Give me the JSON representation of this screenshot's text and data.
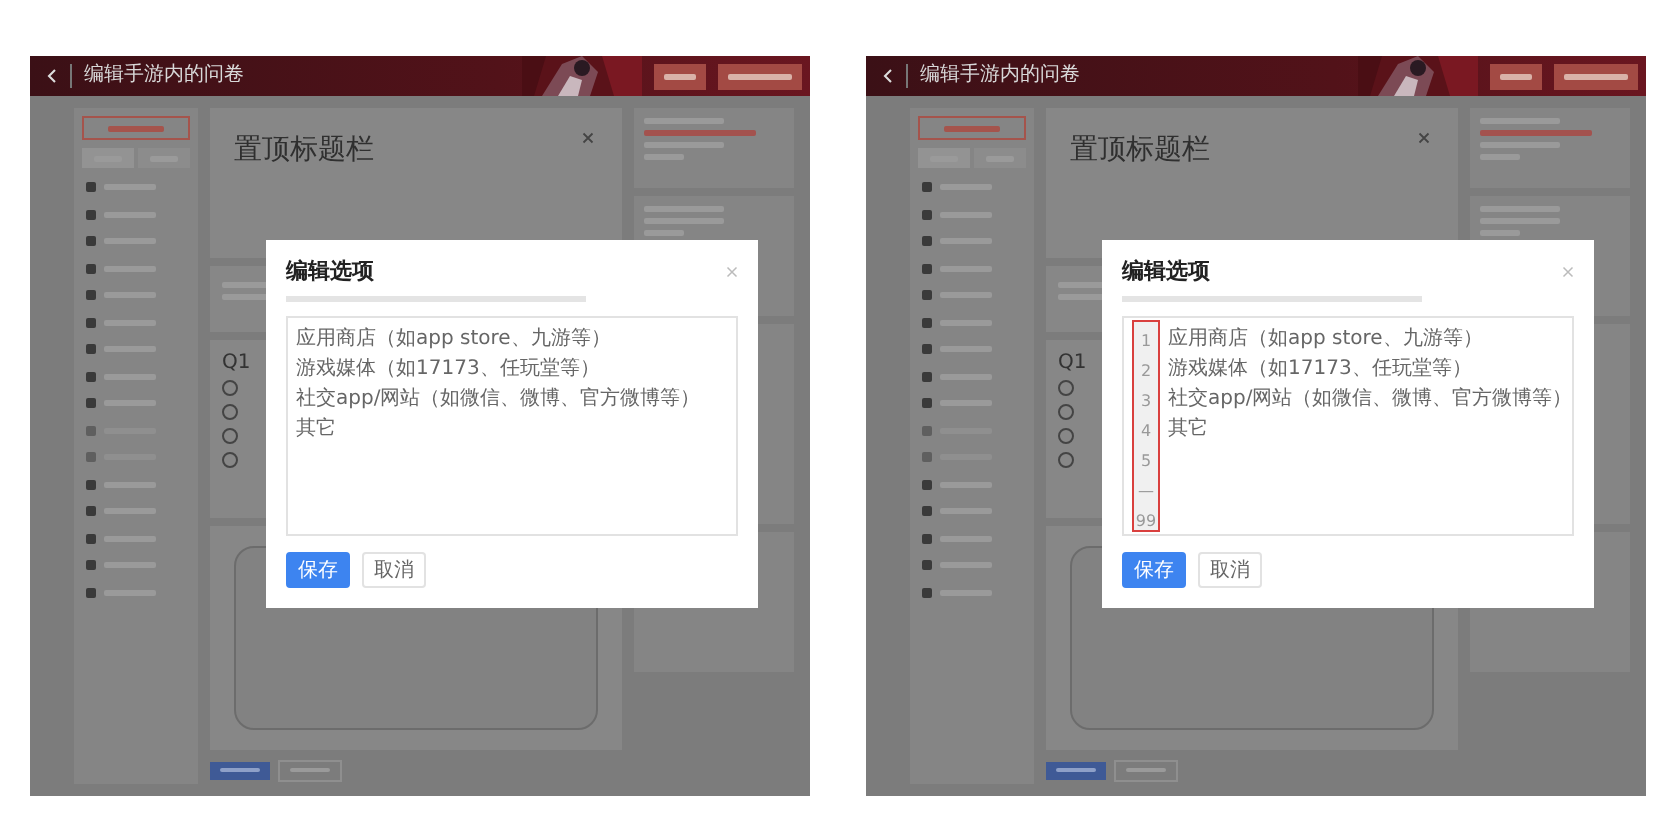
{
  "panels": [
    {
      "header": {
        "title": "编辑手游内的问卷"
      },
      "page_title": "置顶标题栏",
      "question_number": "Q1",
      "radios": [
        {
          "selected": false
        },
        {
          "selected": false
        },
        {
          "selected": false
        },
        {
          "selected": false
        }
      ],
      "dialog": {
        "title": "编辑选项",
        "options": [
          "应用商店（如app store、九游等）",
          "游戏媒体（如17173、任玩堂等）",
          "社交app/网站（如微信、微博、官方微博等）",
          "其它"
        ],
        "buttons": [
          {
            "label": "保存",
            "kind": "primary"
          },
          {
            "label": "取消",
            "kind": "default"
          }
        ]
      }
    },
    {
      "header": {
        "title": "编辑手游内的问卷"
      },
      "page_title": "置顶标题栏",
      "question_number": "Q1",
      "radios": [
        {
          "selected": false
        },
        {
          "selected": false
        },
        {
          "selected": false
        },
        {
          "selected": false
        }
      ],
      "dialog": {
        "title": "编辑选项",
        "line_numbers": {
          "numbers": [
            "1",
            "2",
            "3",
            "4",
            "5",
            "—",
            "99"
          ],
          "highlighted": true
        },
        "options": [
          "应用商店（如app store、九游等）",
          "游戏媒体（如17173、任玩堂等）",
          "社交app/网站（如微信、微博、官方微博等）",
          "其它"
        ],
        "buttons": [
          {
            "label": "保存",
            "kind": "primary"
          },
          {
            "label": "取消",
            "kind": "default"
          }
        ]
      }
    }
  ]
}
